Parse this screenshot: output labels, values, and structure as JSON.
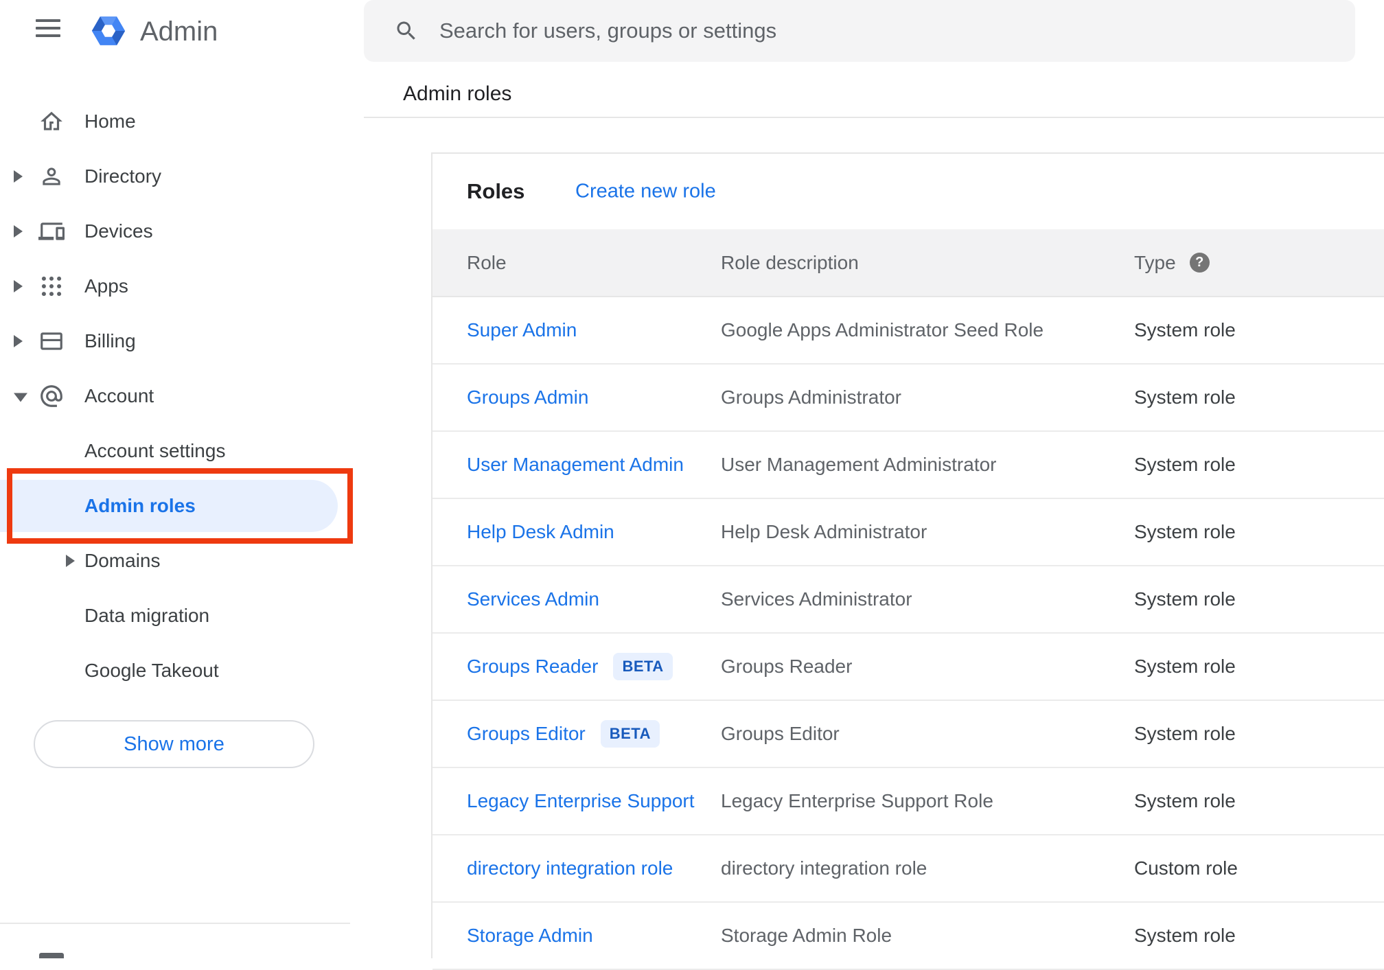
{
  "app": {
    "name": "Admin"
  },
  "search": {
    "placeholder": "Search for users, groups or settings"
  },
  "breadcrumb": "Admin roles",
  "sidebar": {
    "items": [
      {
        "label": "Home",
        "icon": "home",
        "arrow": "none",
        "level": 0,
        "active": false
      },
      {
        "label": "Directory",
        "icon": "person",
        "arrow": "right",
        "level": 0,
        "active": false
      },
      {
        "label": "Devices",
        "icon": "devices",
        "arrow": "right",
        "level": 0,
        "active": false
      },
      {
        "label": "Apps",
        "icon": "apps",
        "arrow": "right",
        "level": 0,
        "active": false
      },
      {
        "label": "Billing",
        "icon": "card",
        "arrow": "right",
        "level": 0,
        "active": false
      },
      {
        "label": "Account",
        "icon": "at",
        "arrow": "down",
        "level": 0,
        "active": false
      },
      {
        "label": "Account settings",
        "icon": "none",
        "arrow": "none",
        "level": 1,
        "active": false
      },
      {
        "label": "Admin roles",
        "icon": "none",
        "arrow": "none",
        "level": 1,
        "active": true
      },
      {
        "label": "Domains",
        "icon": "none",
        "arrow": "right",
        "level": 1,
        "active": false
      },
      {
        "label": "Data migration",
        "icon": "none",
        "arrow": "none",
        "level": 1,
        "active": false
      },
      {
        "label": "Google Takeout",
        "icon": "none",
        "arrow": "none",
        "level": 1,
        "active": false
      }
    ],
    "show_more_label": "Show more"
  },
  "panel": {
    "title": "Roles",
    "create_link": "Create new role",
    "columns": {
      "role": "Role",
      "description": "Role description",
      "type": "Type"
    },
    "help_glyph": "?",
    "rows": [
      {
        "role": "Super Admin",
        "beta": false,
        "description": "Google Apps Administrator Seed Role",
        "type": "System role"
      },
      {
        "role": "Groups Admin",
        "beta": false,
        "description": "Groups Administrator",
        "type": "System role"
      },
      {
        "role": "User Management Admin",
        "beta": false,
        "description": "User Management Administrator",
        "type": "System role"
      },
      {
        "role": "Help Desk Admin",
        "beta": false,
        "description": "Help Desk Administrator",
        "type": "System role"
      },
      {
        "role": "Services Admin",
        "beta": false,
        "description": "Services Administrator",
        "type": "System role"
      },
      {
        "role": "Groups Reader",
        "beta": true,
        "beta_label": "BETA",
        "description": "Groups Reader",
        "type": "System role"
      },
      {
        "role": "Groups Editor",
        "beta": true,
        "beta_label": "BETA",
        "description": "Groups Editor",
        "type": "System role"
      },
      {
        "role": "Legacy Enterprise Support",
        "beta": false,
        "description": "Legacy Enterprise Support Role",
        "type": "System role"
      },
      {
        "role": "directory integration role",
        "beta": false,
        "description": "directory integration role",
        "type": "Custom role"
      },
      {
        "role": "Storage Admin",
        "beta": false,
        "description": "Storage Admin Role",
        "type": "System role"
      }
    ]
  },
  "colors": {
    "accent_blue": "#1a73e8",
    "active_item_bg": "#e8f0fe",
    "annotation_red": "#ee3a10",
    "beta_bg": "#e8f0fe",
    "beta_text": "#185abc",
    "header_row_bg": "#f2f2f3"
  }
}
